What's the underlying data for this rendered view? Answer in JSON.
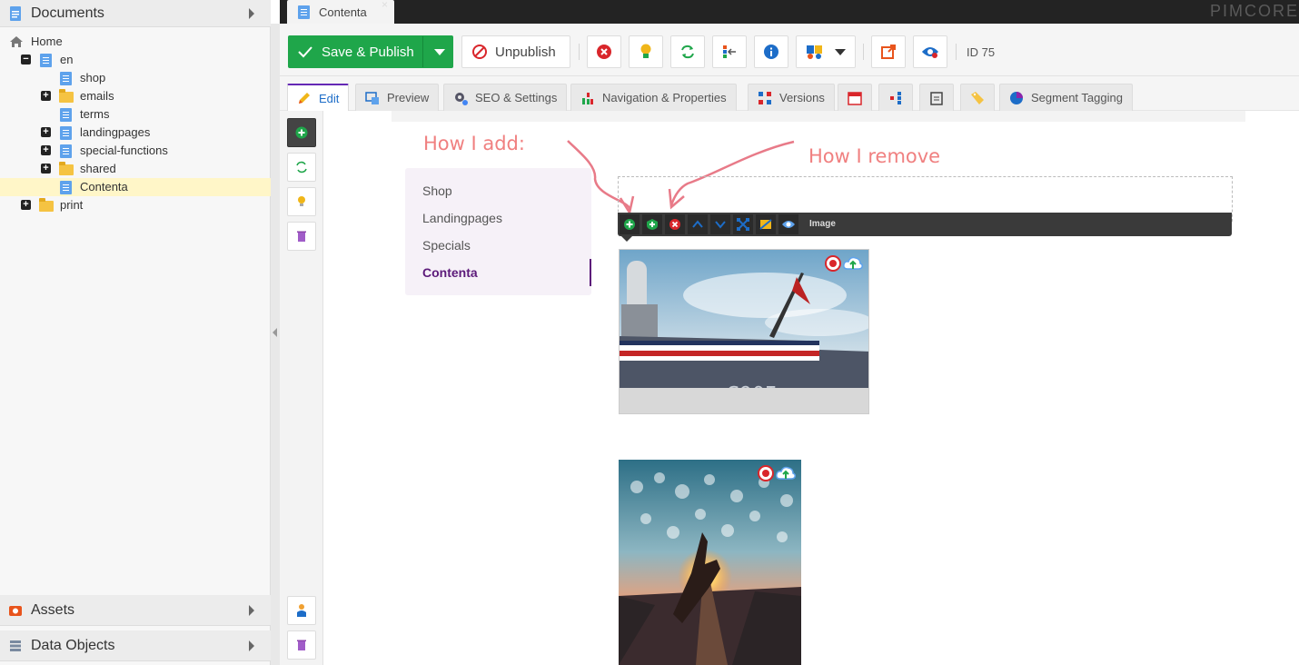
{
  "left_panel": {
    "documents_title": "Documents",
    "assets_title": "Assets",
    "data_objects_title": "Data Objects",
    "tree": [
      {
        "label": "Home",
        "type": "home"
      },
      {
        "label": "en",
        "type": "doc",
        "expander": "−"
      },
      {
        "label": "shop",
        "type": "doc"
      },
      {
        "label": "emails",
        "type": "folder",
        "expander": "+"
      },
      {
        "label": "terms",
        "type": "doc"
      },
      {
        "label": "landingpages",
        "type": "doc",
        "expander": "+"
      },
      {
        "label": "special-functions",
        "type": "doc",
        "expander": "+"
      },
      {
        "label": "shared",
        "type": "folder",
        "expander": "+"
      },
      {
        "label": "Contenta",
        "type": "doc",
        "selected": true
      },
      {
        "label": "print",
        "type": "folder",
        "expander": "+"
      }
    ]
  },
  "topbar": {
    "tab_title": "Contenta",
    "close_glyph": "×",
    "brand": "PIMCORE"
  },
  "toolbar": {
    "save_publish_label": "Save & Publish",
    "unpublish_label": "Unpublish",
    "id_label": "ID 75",
    "icons": [
      "cancel-icon",
      "lightbulb-icon",
      "reload-icon",
      "tree-locate-icon",
      "info-icon",
      "translation-icon",
      "open-external-icon",
      "visibility-icon"
    ]
  },
  "tabs": [
    {
      "label": "Edit",
      "icon": "pencil-icon",
      "active": true
    },
    {
      "label": "Preview",
      "icon": "preview-icon"
    },
    {
      "label": "SEO & Settings",
      "icon": "gear-icon"
    },
    {
      "label": "Navigation & Properties",
      "icon": "properties-icon"
    },
    {
      "label": "Versions",
      "icon": "versions-icon"
    },
    {
      "label": "",
      "icon": "calendar-icon"
    },
    {
      "label": "",
      "icon": "dependencies-icon"
    },
    {
      "label": "",
      "icon": "notes-icon"
    },
    {
      "label": "",
      "icon": "tag-icon"
    },
    {
      "label": "Segment Tagging",
      "icon": "segment-icon"
    }
  ],
  "content": {
    "annotation_add": "How I add:",
    "annotation_remove": "How I remove",
    "nav_items": [
      "Shop",
      "Landingpages",
      "Specials",
      "Contenta"
    ],
    "nav_active": "Contenta",
    "editable_label": "Image",
    "colors": {
      "accent_green": "#1fa64a",
      "brand_purple": "#6428b4",
      "annotation": "#f08080"
    }
  }
}
